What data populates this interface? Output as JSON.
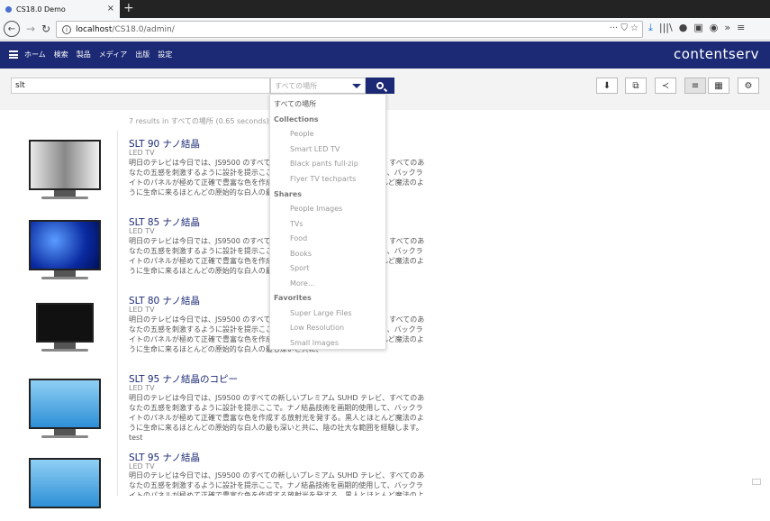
{
  "browser": {
    "tab_title": "CS18.0 Demo",
    "tab_close": "×",
    "new_tab": "+",
    "url_host": "localhost",
    "url_path": "/CS18.0/admin/",
    "url_actions": "··· ⛉ ☆",
    "toolbar_icons": [
      "⤓",
      "|||\\",
      "●",
      "▣",
      "◉",
      "»",
      "≡"
    ]
  },
  "app": {
    "brand": "contentserv",
    "menu": [
      "ホーム",
      "検索",
      "製品",
      "メディア",
      "出版",
      "設定"
    ]
  },
  "search": {
    "query": "slt",
    "scope_selected": "すべての場所",
    "toolbar": [
      "⬇",
      "⧉",
      "≺",
      "≡",
      "▦",
      "⚙"
    ]
  },
  "results_summary": "7 results in すべての場所 (0.65 seconds)",
  "results": [
    {
      "title": "SLT 90 ナノ結晶",
      "category": "LED TV",
      "desc": "明日のテレビは今日では、JS9500 のすべての新しいプレミアム SUHD テレビ、すべてのあなたの五感を刺激するように設計を提示ここで。ナノ結晶技術を画期的使用して、バックライトのパネルが極めて正確で豊富な色を作成する放射光を発する。黒人とほとんど魔法のように生命に来るほとんどの原始的な白人の最も深いと共に、"
    },
    {
      "title": "SLT 85 ナノ結晶",
      "category": "LED TV",
      "desc": "明日のテレビは今日では、JS9500 のすべての新しいプレミアム SUHD テレビ、すべてのあなたの五感を刺激するように設計を提示ここで。ナノ結晶技術を画期的使用して、バックライトのパネルが極めて正確で豊富な色を作成する放射光を発する。黒人とほとんど魔法のように生命に来るほとんどの原始的な白人の最も深いと共に、"
    },
    {
      "title": "SLT 80 ナノ結晶",
      "category": "LED TV",
      "desc": "明日のテレビは今日では、JS9500 のすべての新しいプレミアム SUHD テレビ、すべてのあなたの五感を刺激するように設計を提示ここで。ナノ結晶技術を画期的使用して、バックライトのパネルが極めて正確で豊富な色を作成する放射光を発する。黒人とほとんど魔法のように生命に来るほとんどの原始的な白人の最も深いと共に、"
    },
    {
      "title": "SLT 95 ナノ結晶のコピー",
      "category": "LED TV",
      "desc": "明日のテレビは今日では、JS9500 のすべての新しいプレミアム SUHD テレビ、すべてのあなたの五感を刺激するように設計を提示ここで。ナノ結晶技術を画期的使用して、バックライトのパネルが極めて正確で豊富な色を作成する放射光を発する。黒人とほとんど魔法のように生命に来るほとんどの原始的な白人の最も深いと共に、陰の壮大な範囲を経験します。test"
    },
    {
      "title": "SLT 95 ナノ結晶",
      "category": "LED TV",
      "desc": "明日のテレビは今日では、JS9500 のすべての新しいプレミアム SUHD テレビ、すべてのあなたの五感を刺激するように設計を提示ここで。ナノ結晶技術を画期的使用して、バックライトのパネルが極めて正確で豊富な色を作成する放射光を発する。黒人とほとんど魔法のように生命に来る"
    }
  ],
  "dropdown": {
    "all": "すべての場所",
    "collections_header": "Collections",
    "collections": [
      "People",
      "Smart LED TV",
      "Black pants full-zip",
      "Flyer TV techparts"
    ],
    "shares_header": "Shares",
    "shares": [
      "People Images",
      "TVs",
      "Food",
      "Books",
      "Sport",
      "More..."
    ],
    "favorites_header": "Favorites",
    "favorites": [
      "Super Large Files",
      "Low Resolution",
      "Small Images"
    ]
  }
}
